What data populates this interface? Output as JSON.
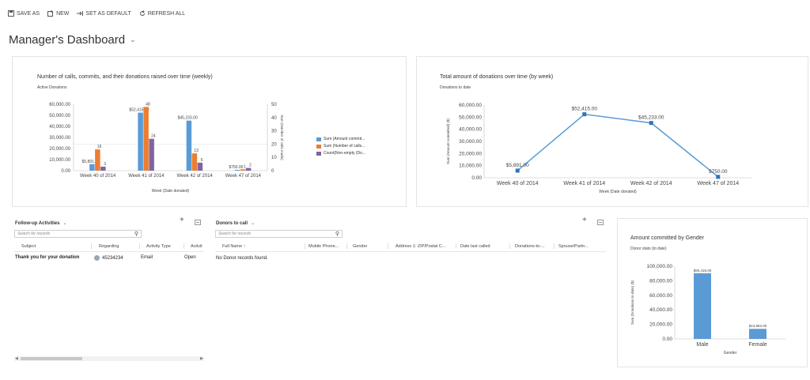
{
  "toolbar": {
    "save_as": "SAVE AS",
    "new": "NEW",
    "set_default": "SET AS DEFAULT",
    "refresh_all": "REFRESH ALL"
  },
  "title": "Manager's Dashboard",
  "colors": {
    "blue": "#5b9bd5",
    "orange": "#ed7d31",
    "purple": "#8064a2"
  },
  "chart_data": [
    {
      "type": "bar",
      "title": "Number of calls, commits, and their donations raised over time (weekly)",
      "subtitle": "Active Donations",
      "categories": [
        "Week 40 of 2014",
        "Week 41 of 2014",
        "Week 42 of 2014",
        "Week 47 of 2014"
      ],
      "xlabel": "Week (Date donated)",
      "ylabel_right": "Sum (Number of calls made)",
      "ylim": [
        0,
        60000
      ],
      "y2lim": [
        0,
        50
      ],
      "yticks": [
        "60,000.00",
        "50,000.00",
        "40,000.00",
        "30,000.00",
        "20,000.00",
        "10,000.00",
        "0.00"
      ],
      "y2ticks": [
        "50",
        "40",
        "30",
        "20",
        "10",
        "0"
      ],
      "series": [
        {
          "name": "Sum (Amount commit...",
          "axis": "left",
          "values": [
            5891,
            52415,
            45233,
            750
          ],
          "labels": [
            "$5,891.00",
            "$52,415.00",
            "$45,233.00",
            "$750.00"
          ]
        },
        {
          "name": "Sum (Number of calls...",
          "axis": "right",
          "values": [
            16,
            48,
            13,
            1
          ],
          "labels": [
            "16",
            "48",
            "13",
            "1"
          ]
        },
        {
          "name": "Count(Non-empty (Do...",
          "axis": "right",
          "values": [
            3,
            24,
            6,
            2
          ],
          "labels": [
            "3",
            "24",
            "6",
            "2"
          ]
        }
      ],
      "legend": "right"
    },
    {
      "type": "line",
      "title": "Total amount of donations over time (by week)",
      "subtitle": "Donations to date",
      "categories": [
        "Week 40 of 2014",
        "Week 41 of 2014",
        "Week 42 of 2014",
        "Week 47 of 2014"
      ],
      "xlabel": "Week (Date donated)",
      "ylabel": "Sum (Amount committed) ($)",
      "ylim": [
        0,
        60000
      ],
      "yticks": [
        "60,000.00",
        "50,000.00",
        "40,000.00",
        "30,000.00",
        "20,000.00",
        "10,000.00",
        "0.00"
      ],
      "values": [
        5891,
        52415,
        45233,
        750
      ],
      "labels": [
        "$5,891.00",
        "$52,415.00",
        "$45,233.00",
        "$750.00"
      ]
    },
    {
      "type": "bar",
      "title": "Amount committed by Gender",
      "subtitle": "Donor stats (to date)",
      "categories": [
        "Male",
        "Female"
      ],
      "xlabel": "Gender",
      "ylabel": "Sum (Donations-to-date) ($)",
      "ylim": [
        0,
        100000
      ],
      "yticks": [
        "100,000.00",
        "80,000.00",
        "60,000.00",
        "40,000.00",
        "20,000.00",
        "0.00"
      ],
      "values": [
        90416,
        13863
      ],
      "labels": [
        "$90,416.00",
        "$13,863.00"
      ]
    }
  ],
  "followup": {
    "title": "Follow-up Activities",
    "search_placeholder": "Search for records",
    "columns": [
      "Subject",
      "Regarding",
      "Activity Type",
      "Activit"
    ],
    "rows": [
      {
        "subject": "Thank you for your donation",
        "regarding": "45234234",
        "type": "Email",
        "status": "Open"
      }
    ]
  },
  "donors": {
    "title": "Donors to call",
    "search_placeholder": "Search for records",
    "columns": [
      "Full Name ↑",
      "Mobile Phone...",
      "Gender",
      "Address 1: ZIP/Postal C...",
      "Date last called",
      "Donations-to-...",
      "Spouse/Partn..."
    ],
    "empty_text": "No Donor records found."
  }
}
